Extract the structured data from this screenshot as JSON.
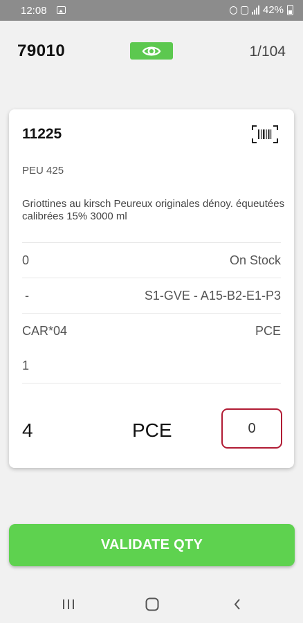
{
  "status_bar": {
    "time": "12:08",
    "battery": "42%",
    "icons": [
      "image-icon",
      "alarm-icon",
      "lock-icon",
      "signal-icon",
      "battery-icon"
    ]
  },
  "header": {
    "order_number": "79010",
    "view_icon": "eye-icon",
    "page_counter": "1/104"
  },
  "product": {
    "code": "11225",
    "barcode_icon": "barcode-scan-icon",
    "reference": "PEU 425",
    "description": "Griottines au kirsch Peureux originales dénoy. équeutées calibrées 15% 3000 ml",
    "stock_qty": "0",
    "stock_label": "On Stock",
    "location_prefix": "-",
    "location": "S1-GVE - A15-B2-E1-P3",
    "packaging": "CAR*04",
    "packaging_unit": "PCE",
    "pack_count": "1",
    "expected_qty": "4",
    "unit": "PCE",
    "counted_qty": "0"
  },
  "actions": {
    "validate_label": "VALIDATE QTY"
  },
  "colors": {
    "accent_green": "#5ed24f",
    "input_border": "#b11b34",
    "status_bar": "#8c8c8c"
  },
  "nav": {
    "icons": [
      "recent-apps-icon",
      "home-icon",
      "back-icon"
    ]
  }
}
